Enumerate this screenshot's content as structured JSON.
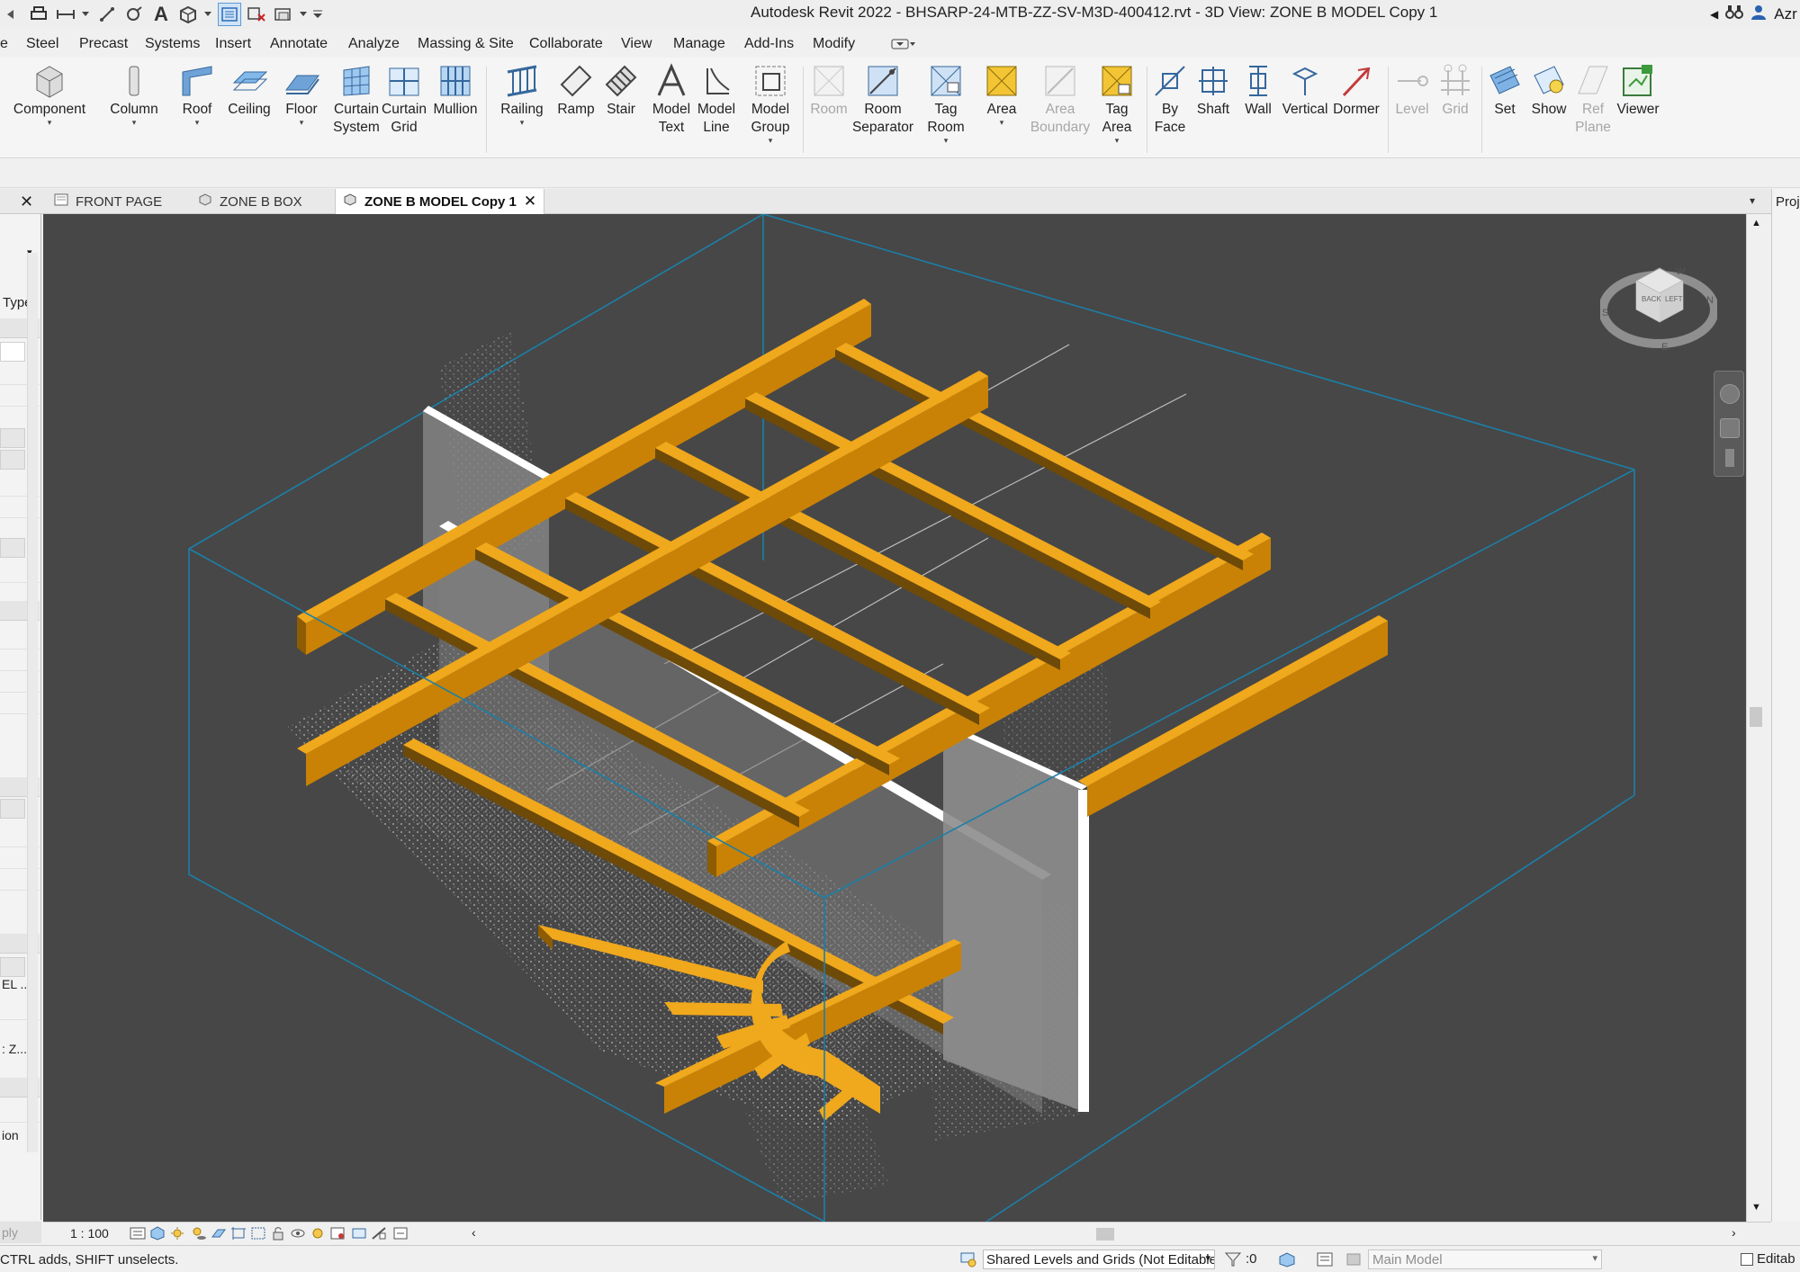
{
  "window": {
    "title": "Autodesk Revit 2022 - BHSARP-24-MTB-ZZ-SV-M3D-400412.rvt - 3D View: ZONE B MODEL Copy 1",
    "user": "Azr"
  },
  "menu_tabs": [
    "e",
    "Steel",
    "Precast",
    "Systems",
    "Insert",
    "Annotate",
    "Analyze",
    "Massing & Site",
    "Collaborate",
    "View",
    "Manage",
    "Add-Ins",
    "Modify"
  ],
  "ribbon": {
    "buttons": [
      {
        "id": "component",
        "label": "Component",
        "enabled": true,
        "dropdown": true
      },
      {
        "id": "column",
        "label": "Column",
        "enabled": true,
        "dropdown": true
      },
      {
        "id": "roof",
        "label": "Roof",
        "enabled": true,
        "dropdown": true
      },
      {
        "id": "ceiling",
        "label": "Ceiling",
        "enabled": true
      },
      {
        "id": "floor",
        "label": "Floor",
        "enabled": true,
        "dropdown": true
      },
      {
        "id": "curtain-system",
        "label": "Curtain\nSystem",
        "enabled": true
      },
      {
        "id": "curtain-grid",
        "label": "Curtain\nGrid",
        "enabled": true
      },
      {
        "id": "mullion",
        "label": "Mullion",
        "enabled": true
      },
      {
        "id": "railing",
        "label": "Railing",
        "enabled": true,
        "dropdown": true
      },
      {
        "id": "ramp",
        "label": "Ramp",
        "enabled": true
      },
      {
        "id": "stair",
        "label": "Stair",
        "enabled": true
      },
      {
        "id": "model-text",
        "label": "Model\nText",
        "enabled": true
      },
      {
        "id": "model-line",
        "label": "Model\nLine",
        "enabled": true
      },
      {
        "id": "model-group",
        "label": "Model\nGroup",
        "enabled": true,
        "dropdown": true
      },
      {
        "id": "room",
        "label": "Room",
        "enabled": false
      },
      {
        "id": "room-separator",
        "label": "Room\nSeparator",
        "enabled": true
      },
      {
        "id": "tag-room",
        "label": "Tag\nRoom",
        "enabled": true,
        "dropdown": true
      },
      {
        "id": "area",
        "label": "Area",
        "enabled": true,
        "dropdown": true
      },
      {
        "id": "area-boundary",
        "label": "Area\nBoundary",
        "enabled": false
      },
      {
        "id": "tag-area",
        "label": "Tag\nArea",
        "enabled": true,
        "dropdown": true
      },
      {
        "id": "by-face",
        "label": "By\nFace",
        "enabled": true
      },
      {
        "id": "shaft",
        "label": "Shaft",
        "enabled": true
      },
      {
        "id": "wall",
        "label": "Wall",
        "enabled": true
      },
      {
        "id": "vertical",
        "label": "Vertical",
        "enabled": true
      },
      {
        "id": "dormer",
        "label": "Dormer",
        "enabled": true
      },
      {
        "id": "level",
        "label": "Level",
        "enabled": false
      },
      {
        "id": "grid",
        "label": "Grid",
        "enabled": false
      },
      {
        "id": "set",
        "label": "Set",
        "enabled": true
      },
      {
        "id": "show",
        "label": "Show",
        "enabled": true
      },
      {
        "id": "ref-plane",
        "label": "Ref\nPlane",
        "enabled": false
      },
      {
        "id": "viewer",
        "label": "Viewer",
        "enabled": true
      }
    ]
  },
  "view_tabs": [
    {
      "label": "FRONT PAGE",
      "active": false
    },
    {
      "label": "ZONE B BOX",
      "active": false
    },
    {
      "label": "ZONE B MODEL Copy 1",
      "active": true
    }
  ],
  "properties_panel": {
    "type_label": "Type",
    "text_cells": [
      "EL ...",
      ": Z...",
      "ion"
    ],
    "apply_label": "ply"
  },
  "right_panel": {
    "label": "Proje"
  },
  "view_control": {
    "scale": "1 : 100"
  },
  "viewcube": {
    "faces": [
      "BACK",
      "LEFT"
    ],
    "compass": [
      "S",
      "N",
      "W",
      "E"
    ]
  },
  "status_bar": {
    "message": "CTRL adds, SHIFT unselects.",
    "workset": "Shared Levels and Grids (Not Editable)",
    "selection_count": ":0",
    "design_option": "Main Model",
    "editable_only": "Editab"
  },
  "colors": {
    "viewport_bg": "#474747",
    "beam_top": "#f0a81c",
    "beam_side": "#c98206",
    "section_box": "#1c7fa8",
    "wall": "#8b8b8b"
  }
}
